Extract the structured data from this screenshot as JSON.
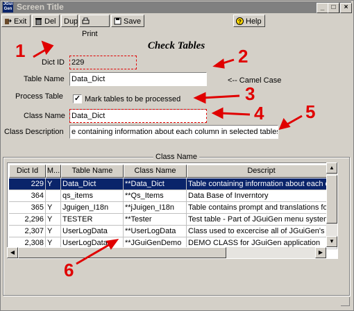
{
  "window": {
    "title": "Screen Title",
    "icon_text": "JGui Gen"
  },
  "title_buttons": {
    "minimize": "_",
    "maximize": "□",
    "close": "×"
  },
  "toolbar": {
    "exit": "Exit",
    "del": "Del",
    "dup": "Dup",
    "print": "Print",
    "save": "Save",
    "help": "Help"
  },
  "form": {
    "title": "Check Tables",
    "dict_id_label": "Dict ID",
    "dict_id_value": "229",
    "table_name_label": "Table Name",
    "table_name_value": "Data_Dict",
    "camel_case_note": "<-- Camel Case",
    "process_table_label": "Process Table",
    "process_checkbox_text": "Mark tables to be processed",
    "process_checked": "✓",
    "class_name_label": "Class Name",
    "class_name_value": "Data_Dict",
    "class_desc_label": "Class Description",
    "class_desc_value": "e containing information about each column in selected tables"
  },
  "grid": {
    "group_label": "Class Name",
    "columns": [
      "Dict Id",
      "M...",
      "Table Name",
      "Class Name",
      "Descript"
    ],
    "rows": [
      [
        "229",
        "Y",
        "Data_Dict",
        "**Data_Dict",
        "Table containing information about each c"
      ],
      [
        "364",
        "",
        "qs_items",
        "**Qs_Items",
        "Data Base of Inverntory"
      ],
      [
        "365",
        "Y",
        "Jguigen_I18n",
        "**jJuigen_I18n",
        "Table contains prompt and translations for"
      ],
      [
        "2,296",
        "Y",
        "TESTER",
        "**Tester",
        "Test table - Part of JGuiGen menu system"
      ],
      [
        "2,307",
        "Y",
        "UserLogData",
        "**UserLogData",
        "Class used to excercise all of JGuiGen's C"
      ],
      [
        "2,308",
        "Y",
        "UserLogData",
        "**JGuiGenDemo",
        "DEMO CLASS for JGuiGen application"
      ]
    ]
  },
  "annotations": [
    "1",
    "2",
    "3",
    "4",
    "5",
    "6"
  ],
  "colors": {
    "selection": "#0a246a",
    "annotation": "#e00000",
    "face": "#d4d0c8"
  }
}
